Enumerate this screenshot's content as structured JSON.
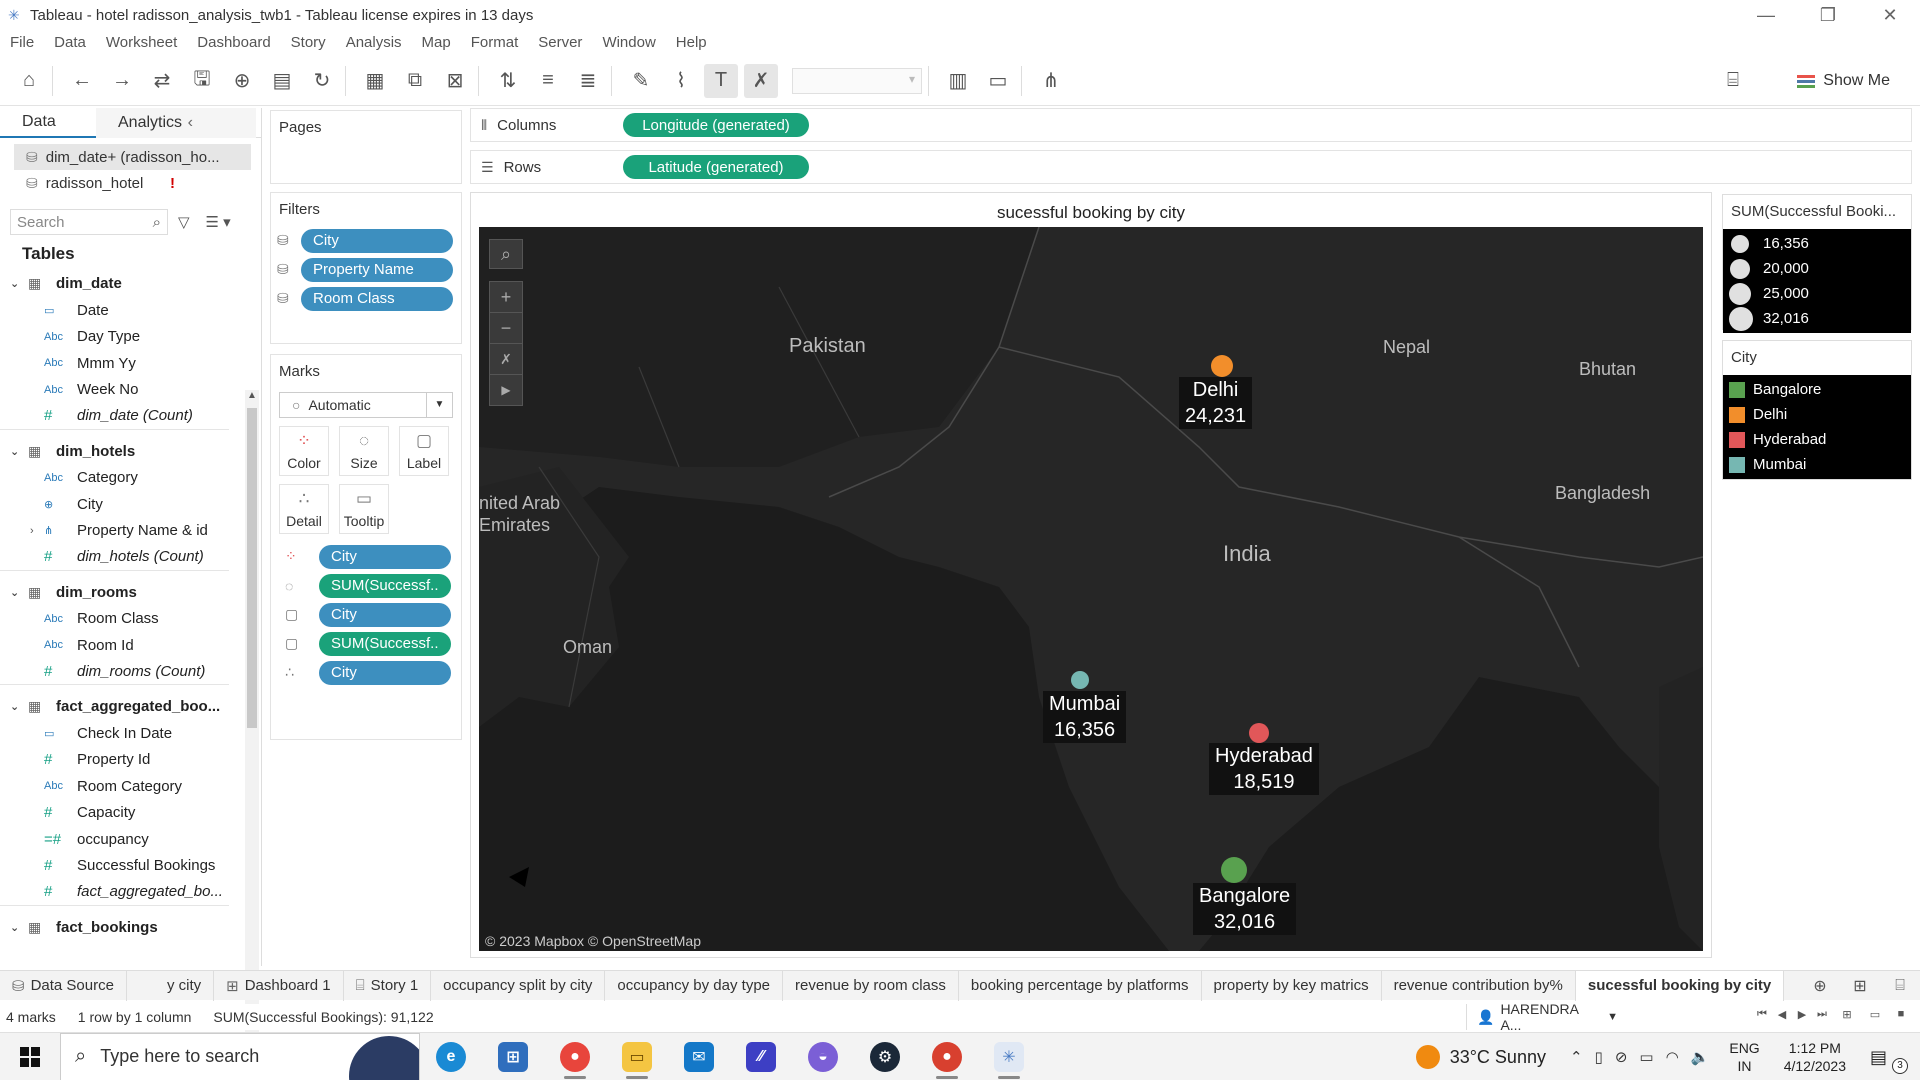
{
  "window": {
    "title": "Tableau - hotel radisson_analysis_twb1 - Tableau license expires in 13 days",
    "controls": [
      "—",
      "❐",
      "✕"
    ]
  },
  "menu": [
    "File",
    "Data",
    "Worksheet",
    "Dashboard",
    "Story",
    "Analysis",
    "Map",
    "Format",
    "Server",
    "Window",
    "Help"
  ],
  "toolbar": {
    "show_me": "Show Me"
  },
  "data_pane": {
    "tabs": {
      "data": "Data",
      "analytics": "Analytics"
    },
    "datasources": [
      {
        "label": "dim_date+ (radisson_ho...",
        "selected": true
      },
      {
        "label": "radisson_hotel",
        "warning": "!"
      }
    ],
    "search_placeholder": "Search",
    "tables_heading": "Tables",
    "tables": [
      {
        "name": "dim_date",
        "fields": [
          {
            "icon": "date",
            "name": "Date"
          },
          {
            "icon": "Abc",
            "name": "Day Type"
          },
          {
            "icon": "Abc",
            "name": "Mmm Yy"
          },
          {
            "icon": "Abc",
            "name": "Week No"
          },
          {
            "icon": "#",
            "name": "dim_date (Count)",
            "italic": true
          }
        ]
      },
      {
        "name": "dim_hotels",
        "fields": [
          {
            "icon": "Abc",
            "name": "Category"
          },
          {
            "icon": "geo",
            "name": "City"
          },
          {
            "icon": "hier",
            "name": "Property Name & id"
          },
          {
            "icon": "#",
            "name": "dim_hotels (Count)",
            "italic": true
          }
        ]
      },
      {
        "name": "dim_rooms",
        "fields": [
          {
            "icon": "Abc",
            "name": "Room Class"
          },
          {
            "icon": "Abc",
            "name": "Room Id"
          },
          {
            "icon": "#",
            "name": "dim_rooms (Count)",
            "italic": true
          }
        ]
      },
      {
        "name": "fact_aggregated_boo...",
        "fields": [
          {
            "icon": "date",
            "name": "Check In Date"
          },
          {
            "icon": "#",
            "name": "Property Id"
          },
          {
            "icon": "Abc",
            "name": "Room Category"
          },
          {
            "icon": "#",
            "name": "Capacity"
          },
          {
            "icon": "=#",
            "name": "occupancy"
          },
          {
            "icon": "#",
            "name": "Successful Bookings"
          },
          {
            "icon": "#",
            "name": "fact_aggregated_bo...",
            "italic": true
          }
        ]
      },
      {
        "name": "fact_bookings",
        "fields": []
      }
    ]
  },
  "pages_card": {
    "title": "Pages"
  },
  "filters_card": {
    "title": "Filters",
    "items": [
      "City",
      "Property Name",
      "Room Class"
    ]
  },
  "marks_card": {
    "title": "Marks",
    "type": "Automatic",
    "buttons": {
      "color": "Color",
      "size": "Size",
      "label": "Label",
      "detail": "Detail",
      "tooltip": "Tooltip"
    },
    "items": [
      {
        "type": "color",
        "label": "City",
        "style": "blue"
      },
      {
        "type": "size",
        "label": "SUM(Successf..",
        "style": "green"
      },
      {
        "type": "label",
        "label": "City",
        "style": "blue"
      },
      {
        "type": "label",
        "label": "SUM(Successf..",
        "style": "green"
      },
      {
        "type": "detail",
        "label": "City",
        "style": "blue"
      }
    ]
  },
  "shelves": {
    "columns": {
      "label": "Columns",
      "pill": "Longitude (generated)"
    },
    "rows": {
      "label": "Rows",
      "pill": "Latitude (generated)"
    }
  },
  "viz": {
    "title": "sucessful booking by city",
    "attribution": "© 2023 Mapbox © OpenStreetMap",
    "map_labels": [
      "Pakistan",
      "Nepal",
      "Bhutan",
      "nited Arab",
      "Emirates",
      "Bangladesh",
      "India",
      "Oman"
    ],
    "cities": [
      {
        "name": "Delhi",
        "value": "24,231",
        "color": "#f28e2b"
      },
      {
        "name": "Mumbai",
        "value": "16,356",
        "color": "#76b7b2"
      },
      {
        "name": "Hyderabad",
        "value": "18,519",
        "color": "#e15759"
      },
      {
        "name": "Bangalore",
        "value": "32,016",
        "color": "#59a14f"
      }
    ]
  },
  "size_legend": {
    "title": "SUM(Successful Booki...",
    "items": [
      "16,356",
      "20,000",
      "25,000",
      "32,016"
    ]
  },
  "color_legend": {
    "title": "City",
    "items": [
      {
        "label": "Bangalore",
        "color": "#59a14f"
      },
      {
        "label": "Delhi",
        "color": "#f28e2b"
      },
      {
        "label": "Hyderabad",
        "color": "#e15759"
      },
      {
        "label": "Mumbai",
        "color": "#76b7b2"
      }
    ]
  },
  "sheet_tabs": [
    {
      "label": "Data Source",
      "icon": "datasource"
    },
    {
      "label": "y city"
    },
    {
      "label": "Dashboard 1",
      "icon": "dashboard"
    },
    {
      "label": "Story 1",
      "icon": "story"
    },
    {
      "label": "occupancy split by city"
    },
    {
      "label": "occupancy by day type"
    },
    {
      "label": "revenue by room class"
    },
    {
      "label": "booking percentage by platforms"
    },
    {
      "label": "property by key matrics"
    },
    {
      "label": "revenue contribution by%"
    },
    {
      "label": "sucessful booking by city",
      "active": true
    }
  ],
  "status": {
    "marks": "4 marks",
    "rows_cols": "1 row by 1 column",
    "sum": "SUM(Successful Bookings): 91,122",
    "user": "HARENDRA A..."
  },
  "taskbar": {
    "search_placeholder": "Type here to search",
    "weather": "33°C  Sunny",
    "lang": [
      "ENG",
      "IN"
    ],
    "time": "1:12 PM",
    "date": "4/12/2023",
    "notifications": "3"
  }
}
